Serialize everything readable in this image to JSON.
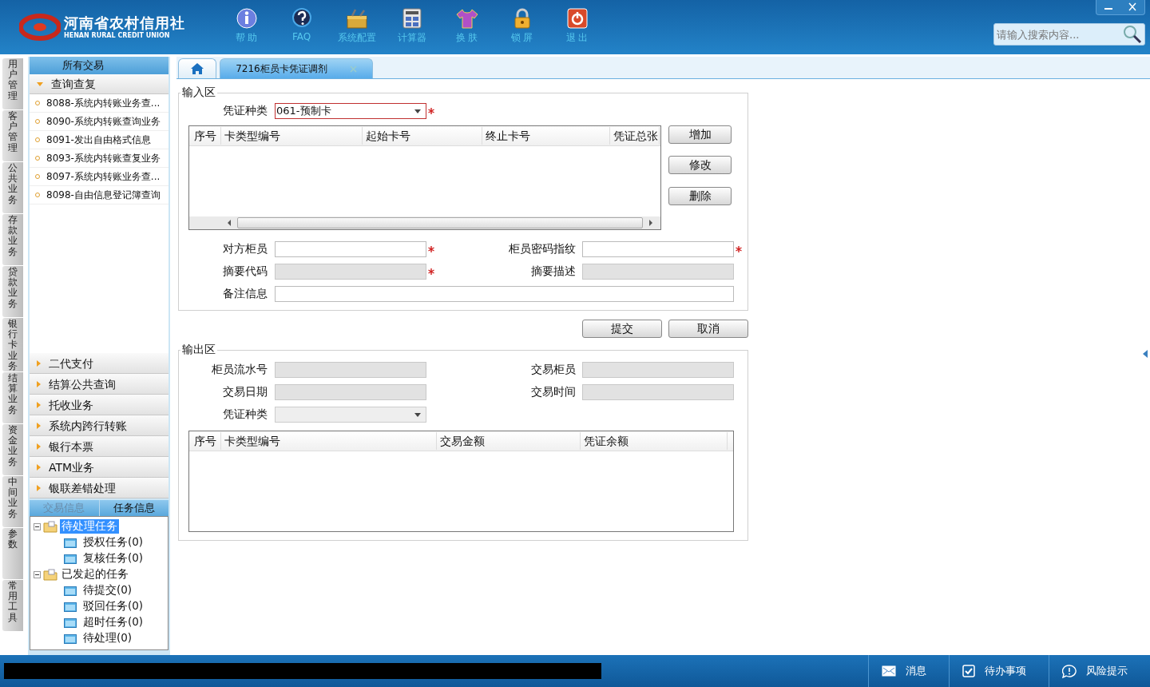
{
  "header": {
    "logo": {
      "name": "河南省农村信用社",
      "subtitle": "HENAN RURAL CREDIT UNION"
    },
    "toolbar": [
      {
        "kind": "info",
        "label": "帮 助"
      },
      {
        "kind": "faq",
        "label": "FAQ"
      },
      {
        "kind": "config",
        "label": "系统配置"
      },
      {
        "kind": "calculator",
        "label": "计算器"
      },
      {
        "kind": "skin",
        "label": "换 肤"
      },
      {
        "kind": "lock",
        "label": "锁 屏"
      },
      {
        "kind": "exit",
        "label": "退 出"
      }
    ],
    "search": {
      "placeholder": "请输入搜索内容..."
    }
  },
  "left_tabs": [
    "用户管理",
    "客户管理",
    "公共业务",
    "存款业务",
    "贷款业务",
    "银行卡业务",
    "结算业务",
    "资金业务",
    "中间业务",
    "参数",
    "常用工具"
  ],
  "sidebar": {
    "title": "所有交易",
    "groups": [
      {
        "label": "查询查复",
        "expanded": true,
        "items": [
          "8088-系统内转账业务查...",
          "8090-系统内转账查询业务",
          "8091-发出自由格式信息",
          "8093-系统内转账查复业务",
          "8097-系统内转账业务查...",
          "8098-自由信息登记簿查询"
        ]
      },
      {
        "label": "二代支付",
        "expanded": false
      },
      {
        "label": "结算公共查询",
        "expanded": false
      },
      {
        "label": "托收业务",
        "expanded": false
      },
      {
        "label": "系统内跨行转账",
        "expanded": false
      },
      {
        "label": "银行本票",
        "expanded": false
      },
      {
        "label": "ATM业务",
        "expanded": false
      },
      {
        "label": "银联差错处理",
        "expanded": false
      }
    ]
  },
  "task_panel": {
    "tabs": [
      {
        "label": "交易信息",
        "selected": false
      },
      {
        "label": "任务信息",
        "selected": true
      }
    ],
    "tree": [
      {
        "label": "待处理任务",
        "selected": true,
        "expanded": true,
        "children": [
          {
            "label": "授权任务(0)",
            "selected": false
          },
          {
            "label": "复核任务(0)",
            "selected": false
          }
        ]
      },
      {
        "label": "已发起的任务",
        "selected": false,
        "expanded": true,
        "children": [
          {
            "label": "待提交(0)",
            "selected": false
          },
          {
            "label": "驳回任务(0)",
            "selected": false
          },
          {
            "label": "超时任务(0)",
            "selected": false
          },
          {
            "label": "待处理(0)",
            "selected": false
          }
        ]
      }
    ]
  },
  "tabs": [
    {
      "label": "7216柜员卡凭证调剂",
      "selected": true
    }
  ],
  "input_section": {
    "title": "输入区",
    "voucher_type": {
      "label": "凭证种类",
      "value": "061-预制卡",
      "required": true
    },
    "table": {
      "columns": [
        "序号",
        "卡类型编号",
        "起始卡号",
        "终止卡号",
        "凭证总张"
      ]
    },
    "table_buttons": [
      "增加",
      "修改",
      "删除"
    ],
    "fields": [
      {
        "label": "对方柜员",
        "required": true,
        "disabled": false,
        "wide": false
      },
      {
        "label": "柜员密码指纹",
        "required": true,
        "disabled": false,
        "wide": false
      },
      {
        "label": "摘要代码",
        "required": true,
        "disabled": true,
        "wide": false
      },
      {
        "label": "摘要描述",
        "required": false,
        "disabled": true,
        "wide": false
      },
      {
        "label": "备注信息",
        "required": false,
        "disabled": false,
        "wide": true
      }
    ]
  },
  "actions": [
    "提交",
    "取消"
  ],
  "output_section": {
    "title": "输出区",
    "fields": [
      {
        "label": "柜员流水号",
        "disabled": true
      },
      {
        "label": "交易柜员",
        "disabled": true
      },
      {
        "label": "交易日期",
        "disabled": true
      },
      {
        "label": "交易时间",
        "disabled": true
      }
    ],
    "voucher_type": {
      "label": "凭证种类",
      "disabled": true
    },
    "table": {
      "columns": [
        "序号",
        "卡类型编号",
        "交易金额",
        "凭证余额"
      ]
    }
  },
  "status_bar": [
    {
      "kind": "message",
      "label": "消息"
    },
    {
      "kind": "todo",
      "label": "待办事项"
    },
    {
      "kind": "risk",
      "label": "风险提示"
    }
  ]
}
